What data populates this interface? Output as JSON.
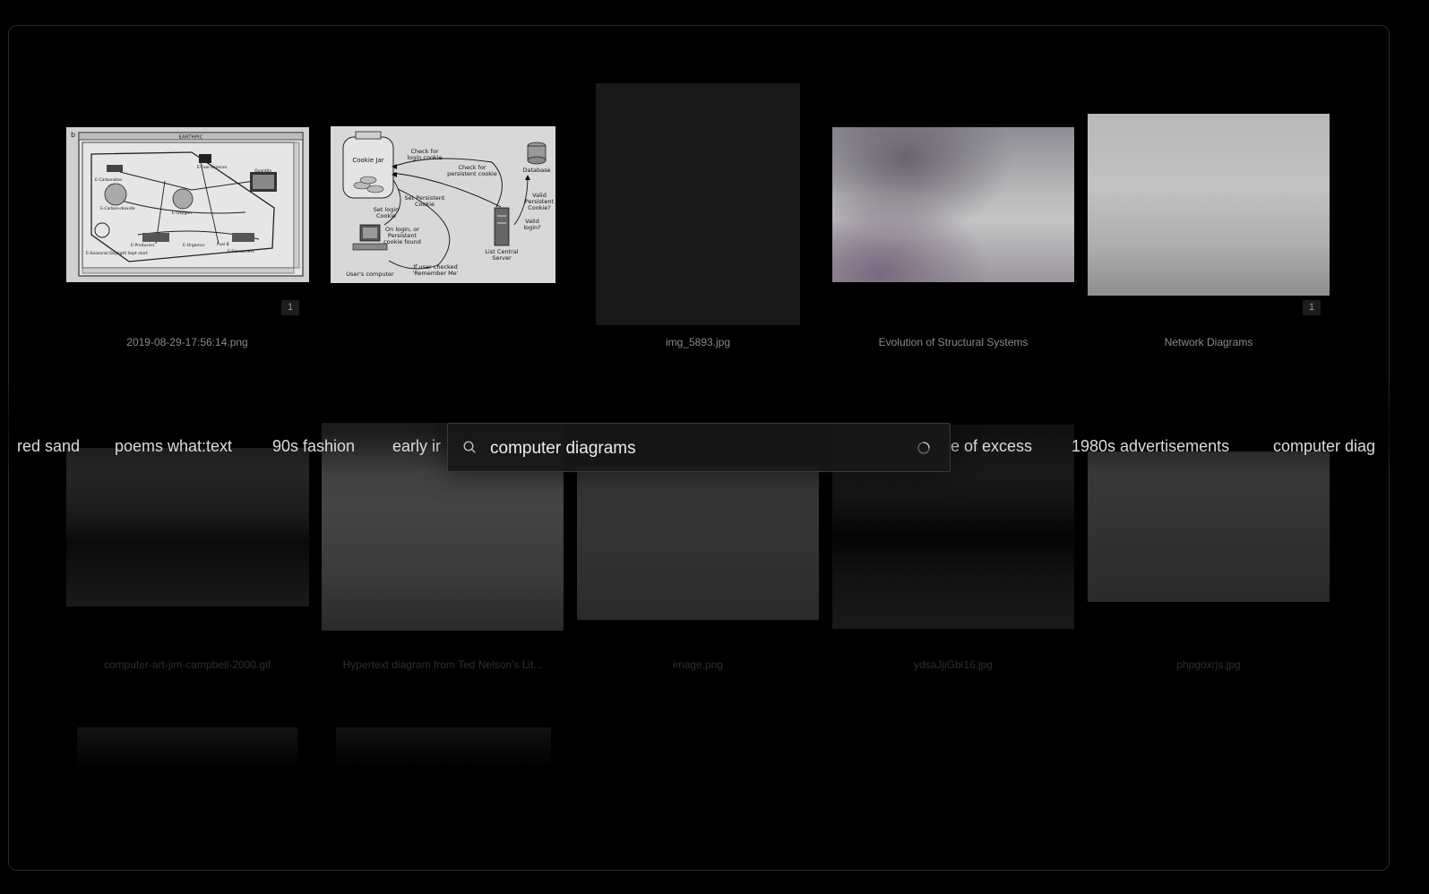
{
  "row1": [
    {
      "caption": "2019-08-29-17:56:14.png",
      "badge": "1"
    },
    {
      "caption": ""
    },
    {
      "caption": "img_5893.jpg"
    },
    {
      "caption": "Evolution of Structural Systems"
    },
    {
      "caption": "Network Diagrams",
      "badge": "1"
    }
  ],
  "row2": [
    {
      "caption": "computer-art-jim-campbell-2000.gif"
    },
    {
      "caption": "Hypertext diagram from Ted Nelson's Lit..."
    },
    {
      "caption": "image.png"
    },
    {
      "caption": "ydsaJjiGbl16.jpg"
    },
    {
      "caption": "phpgoxrjs.jpg"
    }
  ],
  "diagram_earth": {
    "title": "EARTHPIC",
    "corner": "b",
    "labels": [
      "E-Carbonates",
      "E-Carbon-dioxide",
      "E-Oxygen",
      "E-Fuel Reserve",
      "Quantity",
      "E-Producers",
      "E-Organics",
      "E-Consumers",
      "Fuel B",
      "E-Seasonal Daylight Sept start"
    ]
  },
  "diagram_cookie": {
    "cookie_jar": "Cookie Jar",
    "check_login": [
      "Check for",
      "login cookie"
    ],
    "check_persistent": [
      "Check for",
      "persistent cookie"
    ],
    "database": "Database",
    "set_persistent": [
      "Set Persistent",
      "Cookie"
    ],
    "set_login": [
      "Set login",
      "Cookie"
    ],
    "valid_persistent": [
      "Valid",
      "Persistent",
      "Cookie?"
    ],
    "valid_login": [
      "Valid",
      "login?"
    ],
    "on_login": [
      "On login, or",
      "Persistent",
      "cookie found"
    ],
    "server": [
      "List Central",
      "Server"
    ],
    "users_computer": "User's computer",
    "remember": [
      "If user checked",
      "'Remember Me'"
    ]
  },
  "chips": [
    "red sand",
    "poems what:text",
    "90s fashion",
    "early ir",
    "e of excess",
    "1980s advertisements",
    "computer diag"
  ],
  "search": {
    "value": "computer diagrams",
    "placeholder": ""
  },
  "icons": {
    "search": "search-icon",
    "loading": "loading-spinner-icon"
  }
}
